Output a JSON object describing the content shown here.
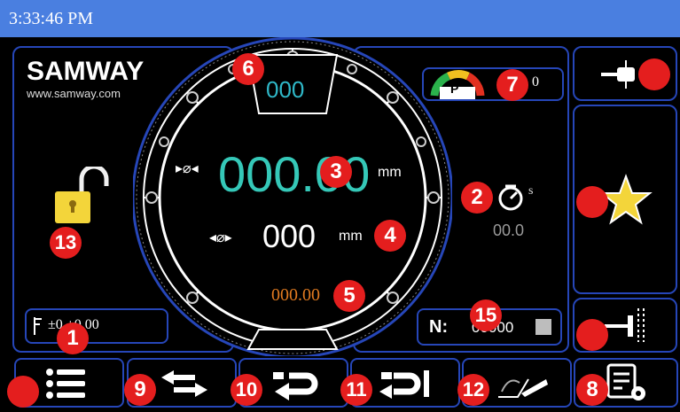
{
  "titlebar": {
    "time": "3:33:46 PM"
  },
  "brand": {
    "name": "SAMWAY",
    "website": "www.samway.com"
  },
  "lock": {
    "icon": "padlock-open-icon"
  },
  "tension": {
    "value_label": "±0  +0.00"
  },
  "dial": {
    "top_counter": "000",
    "outer_diameter": "000.00",
    "outer_unit": "mm",
    "inner_diameter": "000",
    "inner_unit": "mm",
    "offset_value": "000.00"
  },
  "gauge": {
    "letter": "P",
    "value": "0"
  },
  "timer": {
    "unit": "s",
    "value": "00.0"
  },
  "counter": {
    "label": "N:",
    "value": "00000"
  },
  "badges": {
    "b1": "1",
    "b2": "2",
    "b3": "3",
    "b4": "4",
    "b5": "5",
    "b6": "6",
    "b7": "7",
    "b8": "8",
    "b9": "9",
    "b10": "10",
    "b11": "11",
    "b12": "12",
    "b13": "13",
    "b15": "15"
  },
  "colors": {
    "titlebar": "#4a7fe0",
    "panel_border": "#2646b8",
    "outer_value": "#35c8b8",
    "top_counter": "#2fb8c8",
    "offset_value": "#e07a20",
    "badge": "#e41e1e",
    "lock_yellow": "#f3d53a"
  }
}
